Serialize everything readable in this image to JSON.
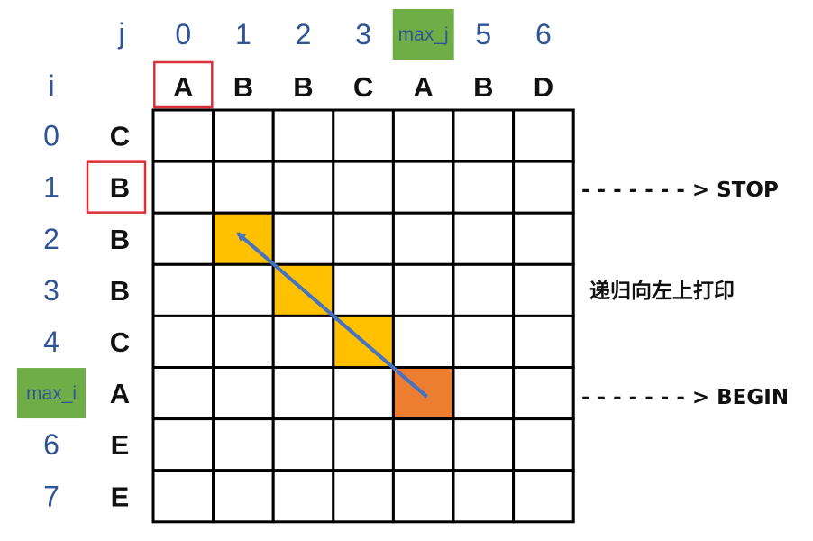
{
  "axis_labels": {
    "j": "j",
    "i": "i"
  },
  "j_indices": [
    "0",
    "1",
    "2",
    "3",
    "max_j",
    "5",
    "6"
  ],
  "i_indices": [
    "0",
    "1",
    "2",
    "3",
    "4",
    "max_i",
    "6",
    "7"
  ],
  "top_string": [
    "A",
    "B",
    "B",
    "C",
    "A",
    "B",
    "D"
  ],
  "left_string": [
    "C",
    "B",
    "B",
    "B",
    "C",
    "A",
    "E",
    "E"
  ],
  "highlighted_top_index": 0,
  "highlighted_left_index": 1,
  "max_j_index": 4,
  "max_i_index": 5,
  "path_cells": [
    {
      "row": 2,
      "col": 1
    },
    {
      "row": 3,
      "col": 2
    },
    {
      "row": 4,
      "col": 3
    }
  ],
  "begin_cell": {
    "row": 5,
    "col": 4
  },
  "annotations": {
    "stop": "- - - - - - - > STOP",
    "begin": "- - - - - - - > BEGIN",
    "note": "递归向左上打印"
  },
  "colors": {
    "index_text": "#2f5597",
    "letter_text": "#111111",
    "highlight_box": "#d9303a",
    "max_badge": "#70ad47",
    "path_cell": "#ffc000",
    "begin_cell": "#ed7d31",
    "arrow": "#4472c4",
    "grid": "#000000"
  }
}
